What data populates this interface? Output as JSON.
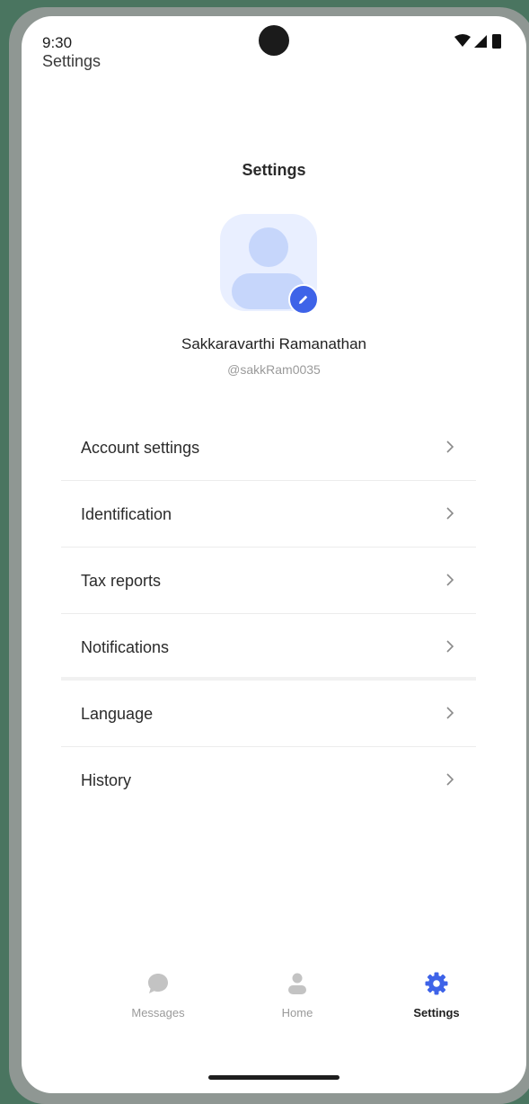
{
  "status_bar": {
    "time": "9:30",
    "app_title": "Settings"
  },
  "header": {
    "title": "Settings"
  },
  "profile": {
    "name": "Sakkaravarthi Ramanathan",
    "handle": "@sakkRam0035"
  },
  "menu": {
    "items": [
      {
        "label": "Account settings"
      },
      {
        "label": "Identification"
      },
      {
        "label": "Tax reports"
      },
      {
        "label": "Notifications"
      },
      {
        "label": "Language"
      },
      {
        "label": "History"
      }
    ]
  },
  "bottom_nav": {
    "items": [
      {
        "label": "Messages",
        "icon": "chat-bubble-icon",
        "active": false
      },
      {
        "label": "Home",
        "icon": "person-icon",
        "active": false
      },
      {
        "label": "Settings",
        "icon": "gear-icon",
        "active": true
      }
    ]
  },
  "colors": {
    "accent": "#3e63e8",
    "inactive": "#c3c3c3",
    "avatar_bg": "#e9efff",
    "avatar_fg": "#c6d6fb"
  }
}
